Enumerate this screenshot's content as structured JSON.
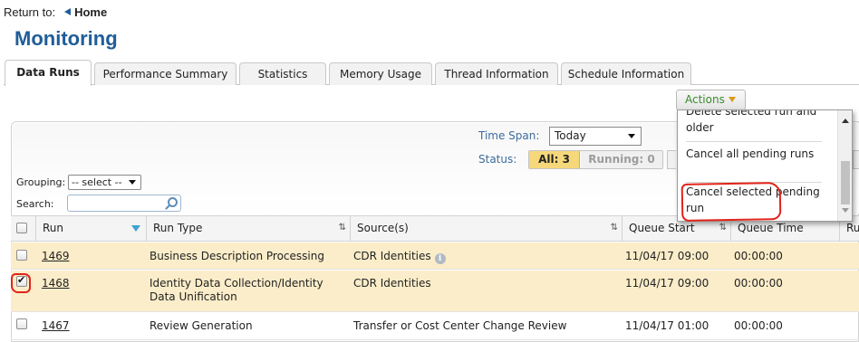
{
  "return_bar": {
    "label": "Return to:",
    "home": "Home"
  },
  "page_title": "Monitoring",
  "tabs": [
    {
      "label": "Data Runs",
      "active": true
    },
    {
      "label": "Performance Summary"
    },
    {
      "label": "Statistics"
    },
    {
      "label": "Memory Usage"
    },
    {
      "label": "Thread Information"
    },
    {
      "label": "Schedule Information"
    }
  ],
  "actions": {
    "label": "Actions"
  },
  "filters": {
    "time_span_label": "Time Span:",
    "time_span_value": "Today",
    "status_label": "Status:",
    "status_all": "All: 3",
    "status_running": "Running: 0",
    "grouping_label": "Grouping:",
    "grouping_value": "-- select --",
    "search_label": "Search:"
  },
  "columns": [
    "Run",
    "Run Type",
    "Source(s)",
    "Queue Start",
    "Queue Time",
    "Ru"
  ],
  "rows": [
    {
      "run": "1469",
      "run_type": "Business Description Processing",
      "source": "CDR Identities",
      "queue_start": "11/04/17 09:00",
      "queue_time": "00:00:00",
      "checked": false
    },
    {
      "run": "1468",
      "run_type": "Identity Data Collection/Identity Data Unification",
      "source": "CDR Identities",
      "queue_start": "11/04/17 09:00",
      "queue_time": "00:00:00",
      "checked": true
    },
    {
      "run": "1467",
      "run_type": "Review Generation",
      "source": "Transfer or Cost Center Change Review",
      "queue_start": "11/04/17 01:00",
      "queue_time": "00:00:00",
      "checked": false
    }
  ],
  "actions_menu": {
    "items": [
      "Delete selected run and older",
      "Cancel all pending runs",
      "Cancel selected pending run"
    ]
  },
  "colors": {
    "title_blue": "#1f5d99",
    "status_all_bg": "#f6d87a",
    "row_highlight": "#fbedc9",
    "annotation_red": "#e2231a",
    "actions_text": "#3a8a2a"
  }
}
